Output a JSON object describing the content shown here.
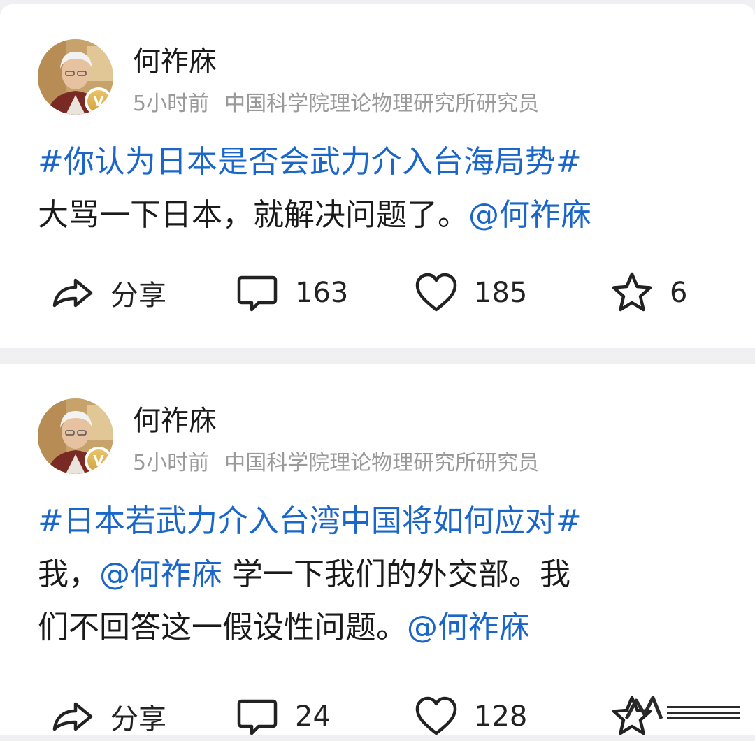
{
  "posts": [
    {
      "author": "何祚庥",
      "time": "5小时前",
      "title": "中国科学院理论物理研究所研究员",
      "badge": "V",
      "content": {
        "line1_topic": "#你认为日本是否会武力介入台海局势#",
        "line2_text": "大骂一下日本，就解决问题了。",
        "line2_mention": "@何祚庥"
      },
      "actions": {
        "share_label": "分享",
        "comments": "163",
        "likes": "185",
        "favorites": "6"
      }
    },
    {
      "author": "何祚庥",
      "time": "5小时前",
      "title": "中国科学院理论物理研究所研究员",
      "badge": "V",
      "content": {
        "line1_topic": "#日本若武力介入台湾中国将如何应对#",
        "line2_pre": "我，",
        "line2_mention": "@何祚庥",
        "line2_post": " 学一下我们的外交部。我",
        "line3_text": "们不回答这一假设性问题。",
        "line3_mention": "@何祚庥"
      },
      "actions": {
        "share_label": "分享",
        "comments": "24",
        "likes": "128"
      }
    }
  ],
  "icons": {
    "share": "share-arrow-icon",
    "comment": "comment-bubble-icon",
    "like": "heart-icon",
    "favorite": "star-icon"
  },
  "colors": {
    "link": "#1b66c9",
    "meta": "#9a9a9a",
    "verified": "#d4a43e"
  }
}
